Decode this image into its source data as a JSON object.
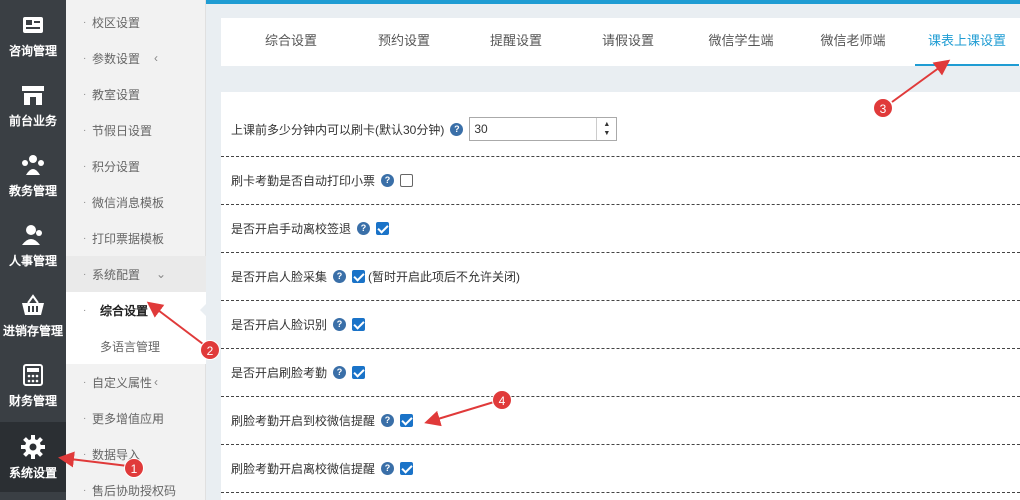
{
  "rail": {
    "items": [
      {
        "label": "咨询管理",
        "icon": "consult-icon"
      },
      {
        "label": "前台业务",
        "icon": "shop-icon"
      },
      {
        "label": "教务管理",
        "icon": "users-icon"
      },
      {
        "label": "人事管理",
        "icon": "person-icon"
      },
      {
        "label": "进销存管理",
        "icon": "basket-icon"
      },
      {
        "label": "财务管理",
        "icon": "calculator-icon"
      },
      {
        "label": "系统设置",
        "icon": "gear-icon"
      }
    ]
  },
  "submenu": {
    "items": [
      {
        "label": "校区设置"
      },
      {
        "label": "参数设置"
      },
      {
        "label": "教室设置"
      },
      {
        "label": "节假日设置"
      },
      {
        "label": "积分设置"
      },
      {
        "label": "微信消息模板"
      },
      {
        "label": "打印票据模板"
      },
      {
        "label": "系统配置"
      },
      {
        "label": "综合设置"
      },
      {
        "label": "多语言管理"
      },
      {
        "label": "自定义属性"
      },
      {
        "label": "更多增值应用"
      },
      {
        "label": "数据导入"
      },
      {
        "label": "售后协助授权码"
      }
    ]
  },
  "tabs": [
    {
      "label": "综合设置"
    },
    {
      "label": "预约设置"
    },
    {
      "label": "提醒设置"
    },
    {
      "label": "请假设置"
    },
    {
      "label": "微信学生端"
    },
    {
      "label": "微信老师端"
    },
    {
      "label": "课表上课设置"
    }
  ],
  "settings": {
    "swipe_minutes": {
      "label": "上课前多少分钟内可以刷卡(默认30分钟)",
      "value": "30"
    },
    "auto_print": {
      "label": "刷卡考勤是否自动打印小票",
      "checked": false
    },
    "manual_leave": {
      "label": "是否开启手动离校签退",
      "checked": true
    },
    "face_collect": {
      "label": "是否开启人脸采集",
      "checked": true,
      "note": "(暂时开启此项后不允许关闭)"
    },
    "face_recognize": {
      "label": "是否开启人脸识别",
      "checked": true
    },
    "face_attendance": {
      "label": "是否开启刷脸考勤",
      "checked": true
    },
    "face_arrive_wechat": {
      "label": "刷脸考勤开启到校微信提醒",
      "checked": true
    },
    "face_leave_wechat": {
      "label": "刷脸考勤开启离校微信提醒",
      "checked": true
    }
  },
  "help_glyph": "?",
  "annotations": [
    "1",
    "2",
    "3",
    "4"
  ],
  "colors": {
    "accent": "#1f9cd3",
    "annotation": "#e03a3a",
    "rail": "#3a3f44"
  }
}
